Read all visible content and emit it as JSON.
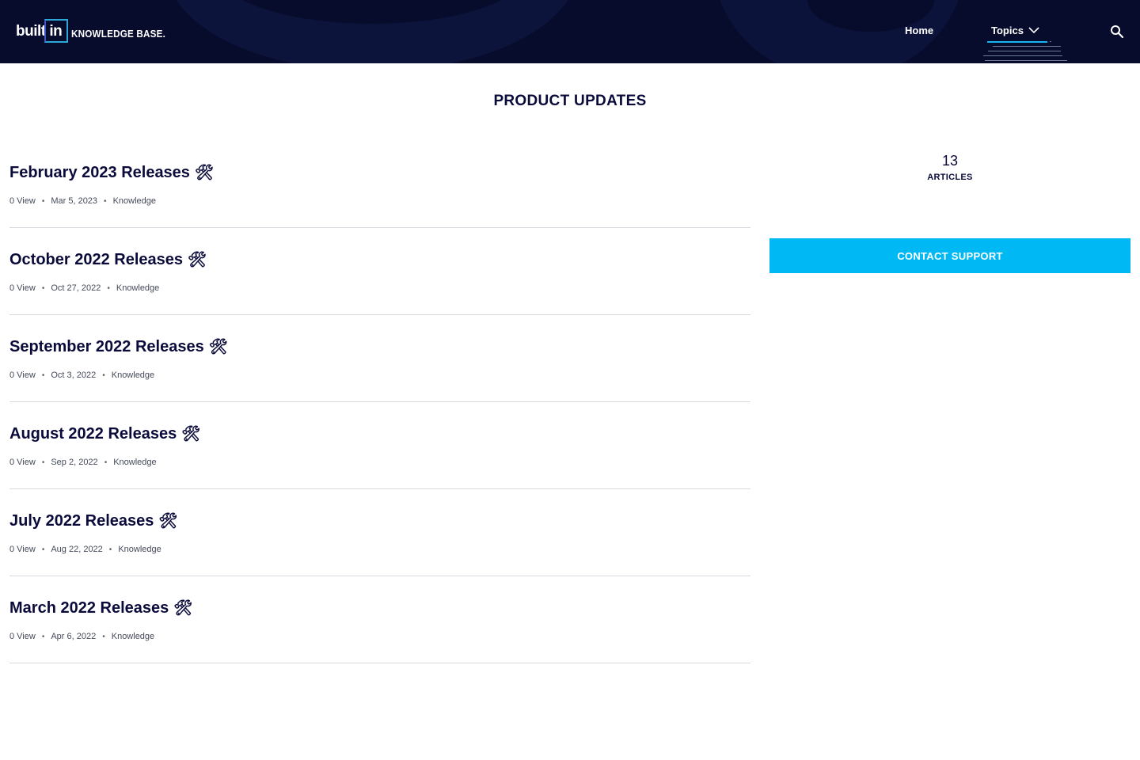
{
  "header": {
    "logo": {
      "brand": "built in",
      "suffix": "KNOWLEDGE BASE."
    },
    "nav": {
      "home": "Home",
      "topics": "Topics"
    },
    "search_icon": "search-icon"
  },
  "page_title": "PRODUCT UPDATES",
  "articles": [
    {
      "title": "February 2023 Releases",
      "icon": "🛠",
      "views": "0 View",
      "date": "Mar 5, 2023",
      "category": "Knowledge"
    },
    {
      "title": "October 2022 Releases",
      "icon": "🛠",
      "views": "0 View",
      "date": "Oct 27, 2022",
      "category": "Knowledge"
    },
    {
      "title": "September 2022 Releases",
      "icon": "🛠",
      "views": "0 View",
      "date": "Oct 3, 2022",
      "category": "Knowledge"
    },
    {
      "title": "August 2022 Releases",
      "icon": "🛠",
      "views": "0 View",
      "date": "Sep 2, 2022",
      "category": "Knowledge"
    },
    {
      "title": "July 2022 Releases",
      "icon": "🛠",
      "views": "0 View",
      "date": "Aug 22, 2022",
      "category": "Knowledge"
    },
    {
      "title": "March 2022 Releases",
      "icon": "🛠",
      "views": "0 View",
      "date": "Apr 6, 2022",
      "category": "Knowledge"
    }
  ],
  "sidebar": {
    "article_count": "13",
    "article_label": "ARTICLES",
    "contact_button": "CONTACT SUPPORT"
  },
  "colors": {
    "header_bg": "#070b2c",
    "accent": "#00b9f4",
    "title_text": "#0b0b3b"
  }
}
